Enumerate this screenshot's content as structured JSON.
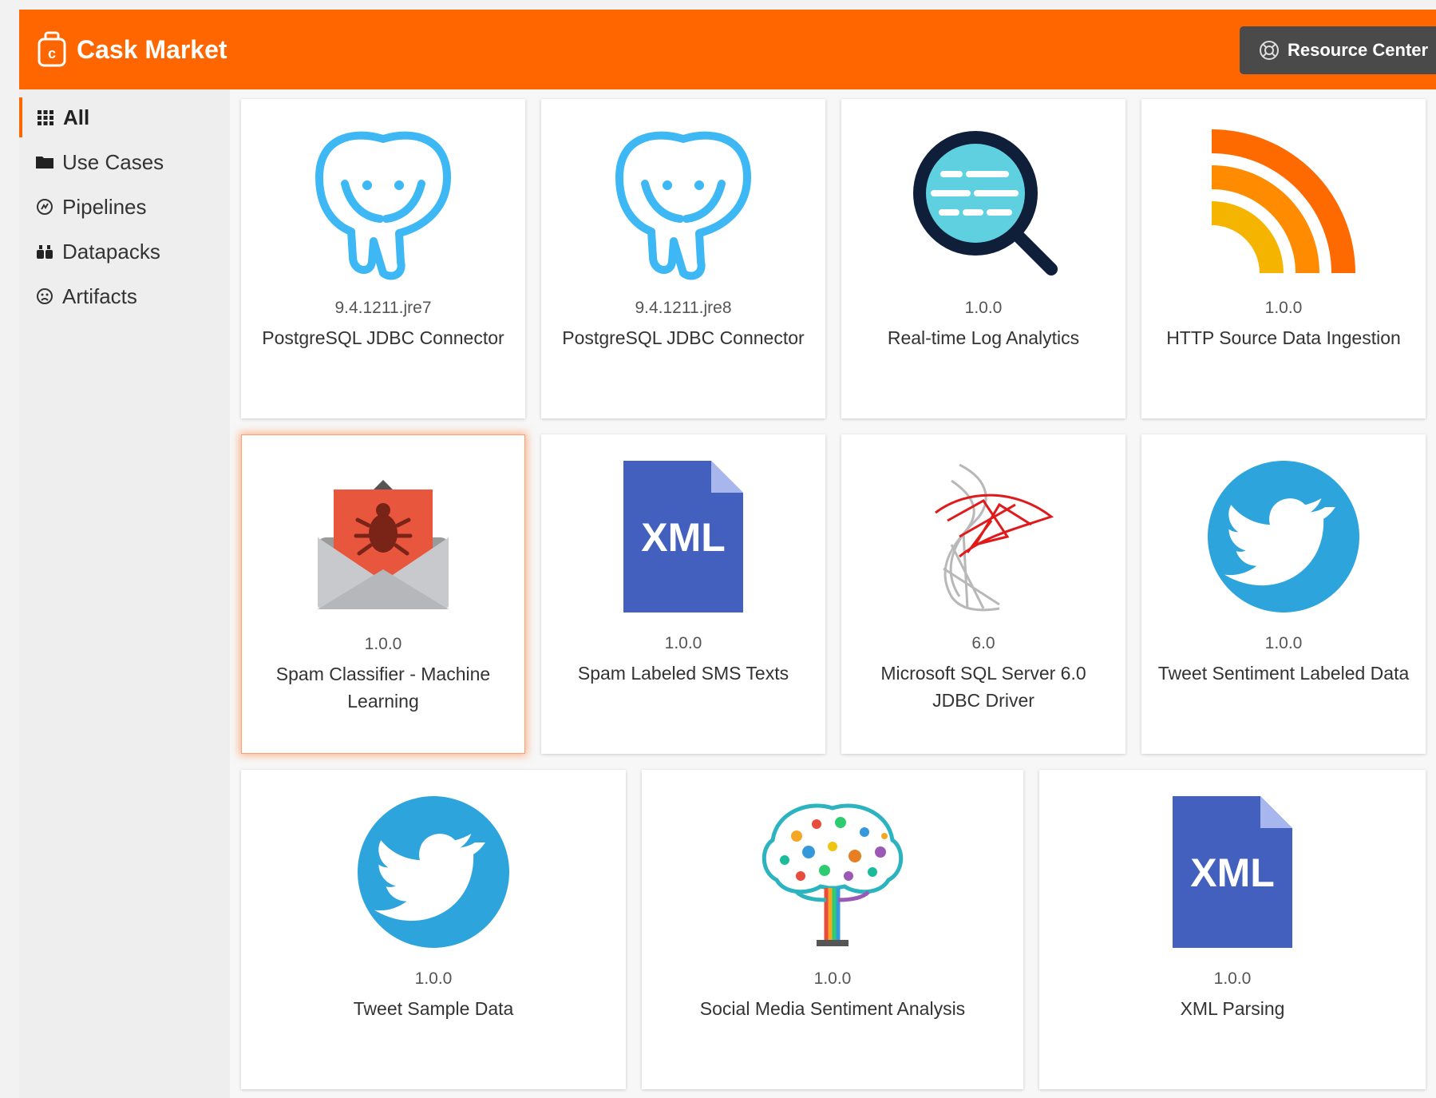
{
  "header": {
    "brand": "Cask Market",
    "resource_center_label": "Resource Center"
  },
  "sidebar": {
    "items": [
      {
        "label": "All",
        "icon": "grid-icon"
      },
      {
        "label": "Use Cases",
        "icon": "folder-icon"
      },
      {
        "label": "Pipelines",
        "icon": "pipeline-icon"
      },
      {
        "label": "Datapacks",
        "icon": "datapacks-icon"
      },
      {
        "label": "Artifacts",
        "icon": "artifacts-icon"
      }
    ]
  },
  "cards": [
    {
      "version": "9.4.1211.jre7",
      "title": "PostgreSQL JDBC Connector",
      "icon": "postgresql-elephant-icon"
    },
    {
      "version": "9.4.1211.jre8",
      "title": "PostgreSQL JDBC Connector",
      "icon": "postgresql-elephant-icon"
    },
    {
      "version": "1.0.0",
      "title": "Real-time Log Analytics",
      "icon": "magnifier-log-icon"
    },
    {
      "version": "1.0.0",
      "title": "HTTP Source Data Ingestion",
      "icon": "rss-feed-icon"
    },
    {
      "version": "1.0.0",
      "title": "Spam Classifier - Machine Learning",
      "icon": "spam-envelope-bug-icon"
    },
    {
      "version": "1.0.0",
      "title": "Spam Labeled SMS Texts",
      "icon": "xml-file-icon"
    },
    {
      "version": "6.0",
      "title": "Microsoft SQL Server 6.0 JDBC Driver",
      "icon": "sql-server-icon"
    },
    {
      "version": "1.0.0",
      "title": "Tweet Sentiment Labeled Data",
      "icon": "twitter-bird-icon"
    },
    {
      "version": "1.0.0",
      "title": "Tweet Sample Data",
      "icon": "twitter-bird-icon"
    },
    {
      "version": "1.0.0",
      "title": "Social Media Sentiment Analysis",
      "icon": "brain-tree-icon"
    },
    {
      "version": "1.0.0",
      "title": "XML Parsing",
      "icon": "xml-file-icon"
    }
  ],
  "xml_label": "XML",
  "colors": {
    "header": "#ff6600",
    "postgres_blue": "#3db8f5",
    "twitter_blue": "#2ea4dc",
    "xml_blue": "#4360be",
    "rss_orange": "#ff6a00"
  }
}
